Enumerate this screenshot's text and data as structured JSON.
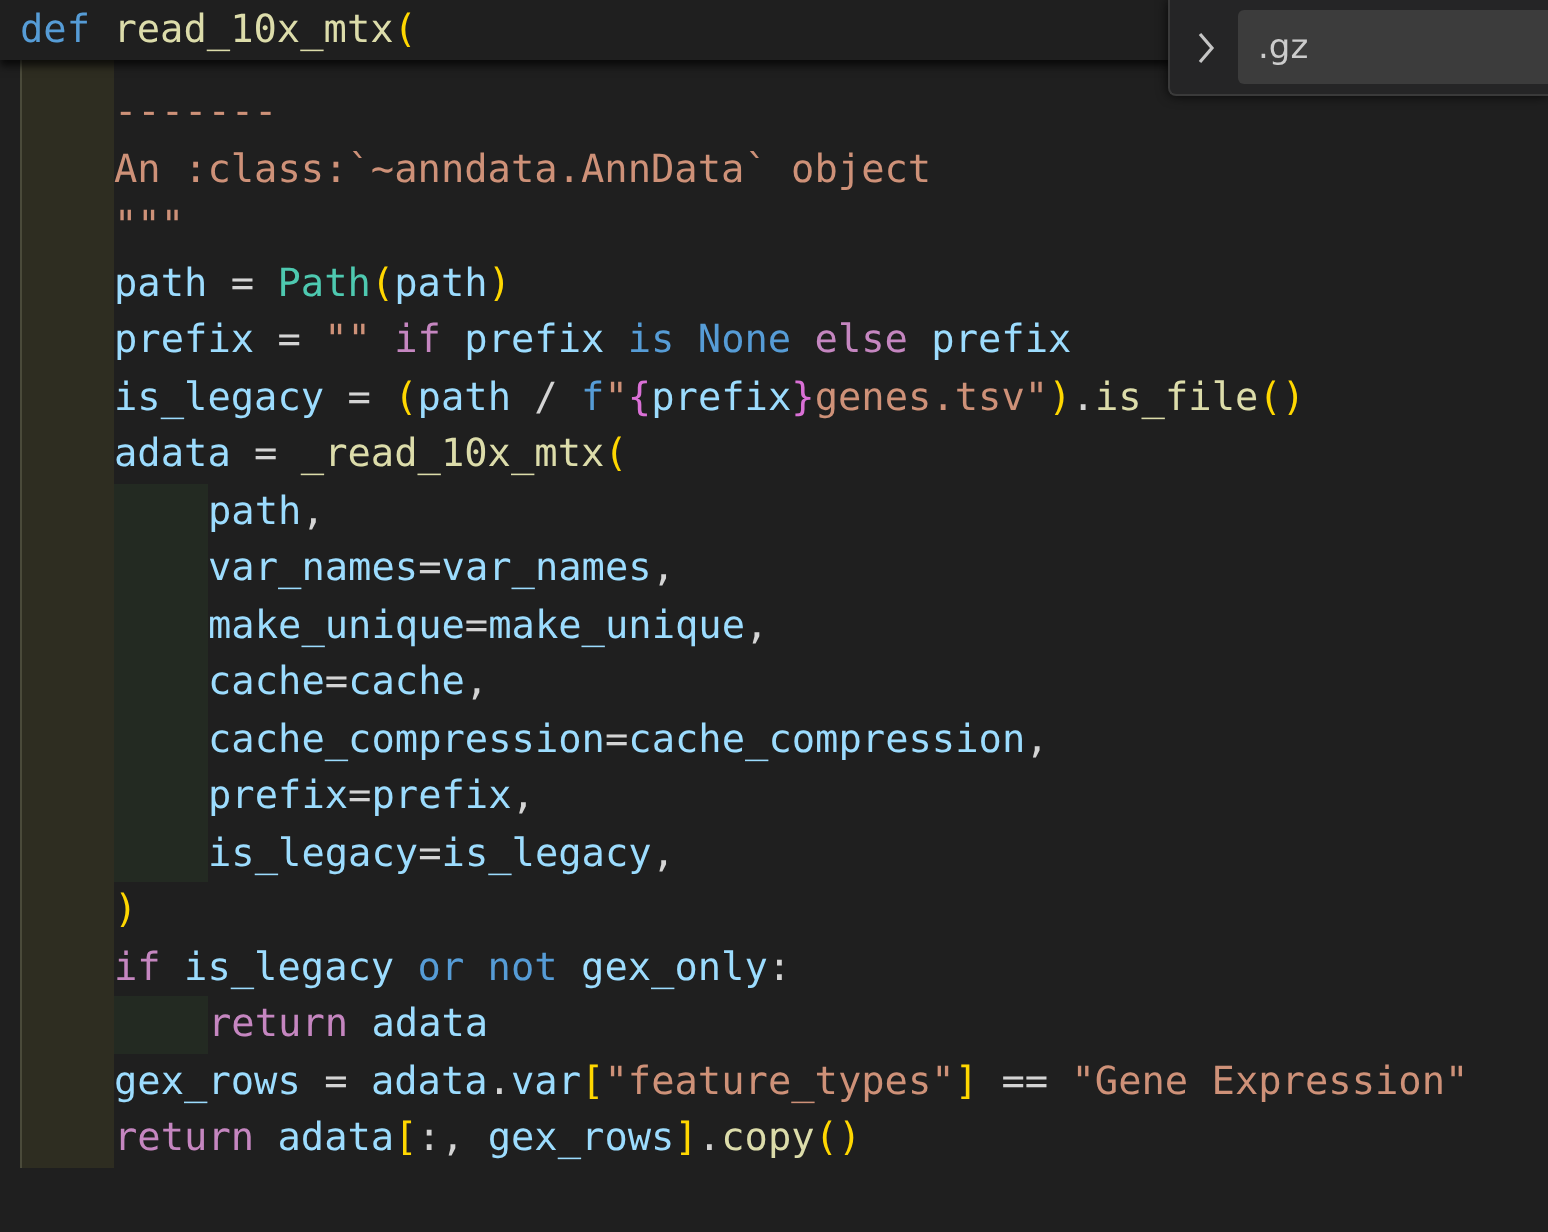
{
  "sticky_header": {
    "tokens": [
      {
        "text": "def ",
        "kind": "keyword"
      },
      {
        "text": "read_10x_mtx",
        "kind": "function"
      },
      {
        "text": "(",
        "kind": "bracket1"
      }
    ]
  },
  "find_widget": {
    "expanded": false,
    "value": ".gz"
  },
  "lines": [
    {
      "tokens": [
        {
          "text": "-------",
          "kind": "string"
        }
      ]
    },
    {
      "tokens": [
        {
          "text": "An :class:`~anndata.AnnData` object",
          "kind": "string"
        }
      ]
    },
    {
      "tokens": [
        {
          "text": "\"\"\"",
          "kind": "string"
        }
      ]
    },
    {
      "tokens": [
        {
          "text": "path",
          "kind": "variable"
        },
        {
          "text": " = ",
          "kind": "plain"
        },
        {
          "text": "Path",
          "kind": "class"
        },
        {
          "text": "(",
          "kind": "bracket1"
        },
        {
          "text": "path",
          "kind": "variable"
        },
        {
          "text": ")",
          "kind": "bracket1"
        }
      ]
    },
    {
      "tokens": [
        {
          "text": "prefix",
          "kind": "variable"
        },
        {
          "text": " = ",
          "kind": "plain"
        },
        {
          "text": "\"\" ",
          "kind": "string"
        },
        {
          "text": "if ",
          "kind": "control"
        },
        {
          "text": "prefix ",
          "kind": "variable"
        },
        {
          "text": "is None ",
          "kind": "keyword"
        },
        {
          "text": "else ",
          "kind": "control"
        },
        {
          "text": "prefix",
          "kind": "variable"
        }
      ]
    },
    {
      "tokens": [
        {
          "text": "is_legacy",
          "kind": "variable"
        },
        {
          "text": " = ",
          "kind": "plain"
        },
        {
          "text": "(",
          "kind": "bracket1"
        },
        {
          "text": "path",
          "kind": "variable"
        },
        {
          "text": " / ",
          "kind": "plain"
        },
        {
          "text": "f",
          "kind": "keyword"
        },
        {
          "text": "\"",
          "kind": "string"
        },
        {
          "text": "{",
          "kind": "bracket2"
        },
        {
          "text": "prefix",
          "kind": "variable"
        },
        {
          "text": "}",
          "kind": "bracket2"
        },
        {
          "text": "genes.tsv\"",
          "kind": "string"
        },
        {
          "text": ")",
          "kind": "bracket1"
        },
        {
          "text": ".",
          "kind": "plain"
        },
        {
          "text": "is_file",
          "kind": "function"
        },
        {
          "text": "()",
          "kind": "bracket1"
        }
      ]
    },
    {
      "tokens": [
        {
          "text": "adata",
          "kind": "variable"
        },
        {
          "text": " = ",
          "kind": "plain"
        },
        {
          "text": "_read_10x_mtx",
          "kind": "function"
        },
        {
          "text": "(",
          "kind": "bracket1"
        }
      ],
      "children": [
        {
          "tokens": [
            {
              "text": "path",
              "kind": "variable"
            },
            {
              "text": ",",
              "kind": "plain"
            }
          ]
        },
        {
          "tokens": [
            {
              "text": "var_names",
              "kind": "variable"
            },
            {
              "text": "=",
              "kind": "plain"
            },
            {
              "text": "var_names",
              "kind": "variable"
            },
            {
              "text": ",",
              "kind": "plain"
            }
          ]
        },
        {
          "tokens": [
            {
              "text": "make_unique",
              "kind": "variable"
            },
            {
              "text": "=",
              "kind": "plain"
            },
            {
              "text": "make_unique",
              "kind": "variable"
            },
            {
              "text": ",",
              "kind": "plain"
            }
          ]
        },
        {
          "tokens": [
            {
              "text": "cache",
              "kind": "variable"
            },
            {
              "text": "=",
              "kind": "plain"
            },
            {
              "text": "cache",
              "kind": "variable"
            },
            {
              "text": ",",
              "kind": "plain"
            }
          ]
        },
        {
          "tokens": [
            {
              "text": "cache_compression",
              "kind": "variable"
            },
            {
              "text": "=",
              "kind": "plain"
            },
            {
              "text": "cache_compression",
              "kind": "variable"
            },
            {
              "text": ",",
              "kind": "plain"
            }
          ]
        },
        {
          "tokens": [
            {
              "text": "prefix",
              "kind": "variable"
            },
            {
              "text": "=",
              "kind": "plain"
            },
            {
              "text": "prefix",
              "kind": "variable"
            },
            {
              "text": ",",
              "kind": "plain"
            }
          ]
        },
        {
          "tokens": [
            {
              "text": "is_legacy",
              "kind": "variable"
            },
            {
              "text": "=",
              "kind": "plain"
            },
            {
              "text": "is_legacy",
              "kind": "variable"
            },
            {
              "text": ",",
              "kind": "plain"
            }
          ]
        }
      ]
    },
    {
      "tokens": [
        {
          "text": ")",
          "kind": "bracket1"
        }
      ]
    },
    {
      "tokens": [
        {
          "text": "if ",
          "kind": "control"
        },
        {
          "text": "is_legacy ",
          "kind": "variable"
        },
        {
          "text": "or not ",
          "kind": "keyword"
        },
        {
          "text": "gex_only",
          "kind": "variable"
        },
        {
          "text": ":",
          "kind": "plain"
        }
      ],
      "children": [
        {
          "tokens": [
            {
              "text": "return ",
              "kind": "control"
            },
            {
              "text": "adata",
              "kind": "variable"
            }
          ]
        }
      ]
    },
    {
      "tokens": [
        {
          "text": "gex_rows",
          "kind": "variable"
        },
        {
          "text": " = ",
          "kind": "plain"
        },
        {
          "text": "adata",
          "kind": "variable"
        },
        {
          "text": ".",
          "kind": "plain"
        },
        {
          "text": "var",
          "kind": "variable"
        },
        {
          "text": "[",
          "kind": "bracket1"
        },
        {
          "text": "\"feature_types\"",
          "kind": "string"
        },
        {
          "text": "]",
          "kind": "bracket1"
        },
        {
          "text": " == ",
          "kind": "plain"
        },
        {
          "text": "\"Gene Expression\"",
          "kind": "string"
        }
      ]
    },
    {
      "tokens": [
        {
          "text": "return ",
          "kind": "control"
        },
        {
          "text": "adata",
          "kind": "variable"
        },
        {
          "text": "[",
          "kind": "bracket1"
        },
        {
          "text": ":, ",
          "kind": "plain"
        },
        {
          "text": "gex_rows",
          "kind": "variable"
        },
        {
          "text": "]",
          "kind": "bracket1"
        },
        {
          "text": ".",
          "kind": "plain"
        },
        {
          "text": "copy",
          "kind": "function"
        },
        {
          "text": "()",
          "kind": "bracket1"
        }
      ]
    }
  ]
}
